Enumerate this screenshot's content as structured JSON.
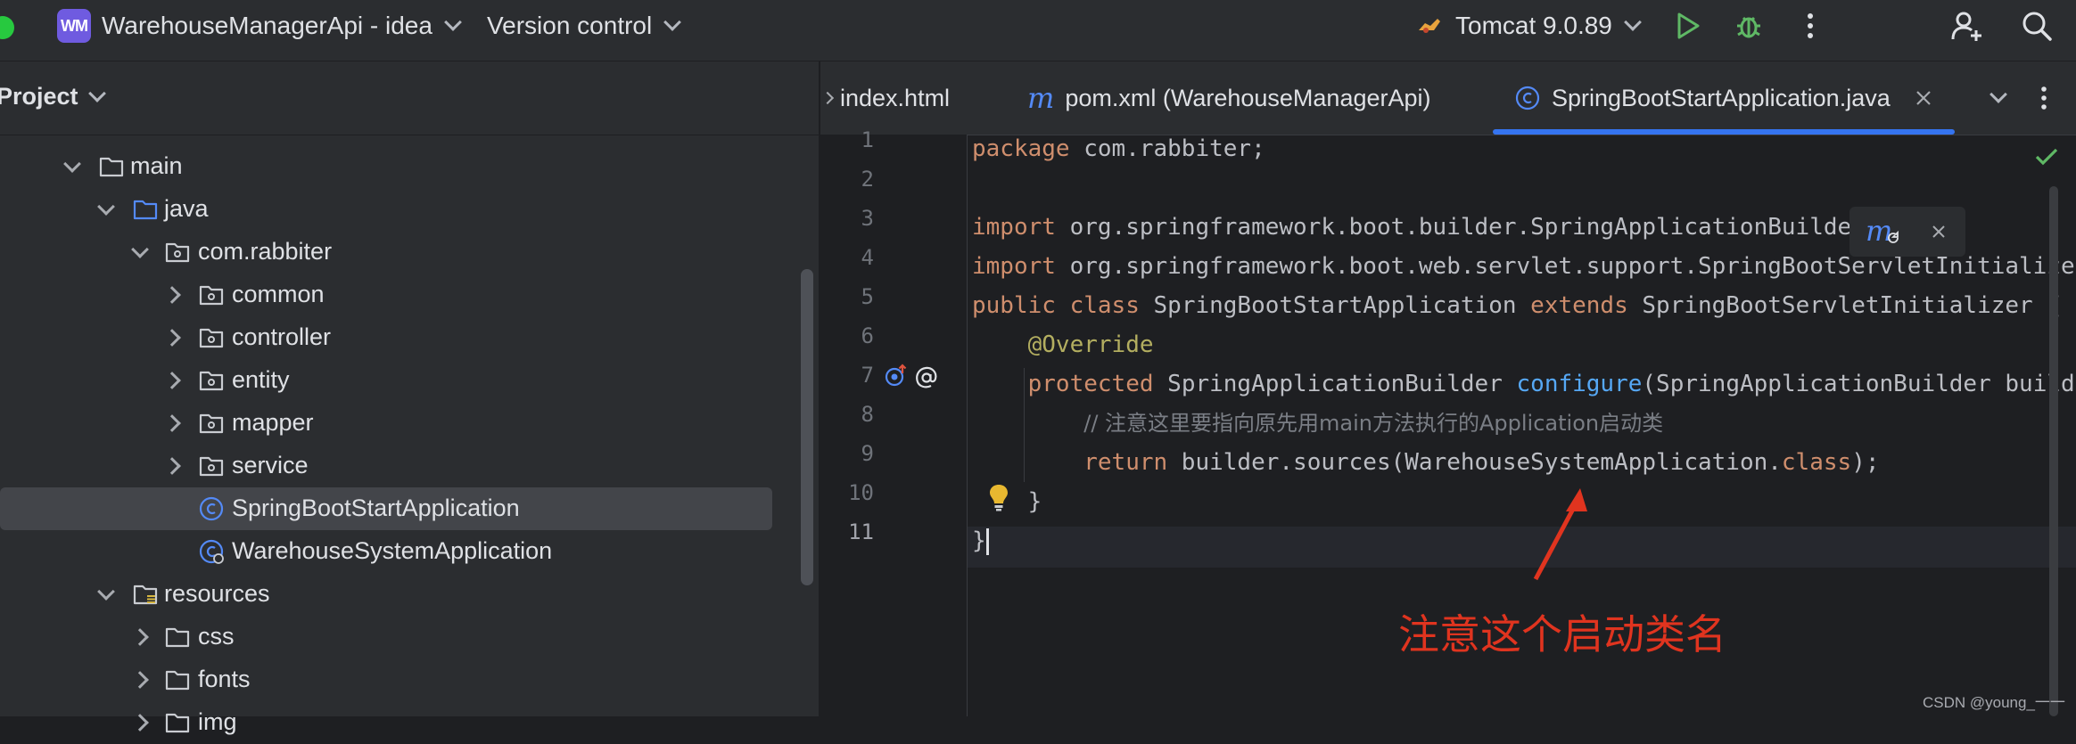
{
  "toolbar": {
    "project_badge": "WM",
    "project_name": "WarehouseManagerApi - idea",
    "version_control": "Version control",
    "run_config": "Tomcat 9.0.89"
  },
  "project_panel": {
    "title": "Project",
    "tree": [
      {
        "label": "main",
        "type": "folder",
        "expanded": true
      },
      {
        "label": "java",
        "type": "source-folder",
        "expanded": true
      },
      {
        "label": "com.rabbiter",
        "type": "package",
        "expanded": true
      },
      {
        "label": "common",
        "type": "package",
        "expanded": false
      },
      {
        "label": "controller",
        "type": "package",
        "expanded": false
      },
      {
        "label": "entity",
        "type": "package",
        "expanded": false
      },
      {
        "label": "mapper",
        "type": "package",
        "expanded": false
      },
      {
        "label": "service",
        "type": "package",
        "expanded": false
      },
      {
        "label": "SpringBootStartApplication",
        "type": "class",
        "selected": true
      },
      {
        "label": "WarehouseSystemApplication",
        "type": "boot-class"
      },
      {
        "label": "resources",
        "type": "resources-folder",
        "expanded": true
      },
      {
        "label": "css",
        "type": "folder",
        "expanded": false
      },
      {
        "label": "fonts",
        "type": "folder",
        "expanded": false
      },
      {
        "label": "img",
        "type": "folder",
        "expanded": false
      }
    ]
  },
  "editor": {
    "tabs": [
      {
        "label": "index.html",
        "active": false
      },
      {
        "label": "pom.xml (WarehouseManagerApi)",
        "icon": "m",
        "active": false
      },
      {
        "label": "SpringBootStartApplication.java",
        "active": true
      }
    ],
    "line_numbers": [
      "1",
      "2",
      "3",
      "4",
      "5",
      "6",
      "7",
      "8",
      "9",
      "10",
      "11"
    ],
    "code": {
      "l1": {
        "kw": "package",
        "rest": " com.rabbiter;"
      },
      "l3": {
        "kw": "import",
        "rest": " org.springframework.boot.builder.SpringApplicationBuilder;"
      },
      "l4": {
        "kw": "import",
        "rest": " org.springframework.boot.web.servlet.support.SpringBootServletInitializer;"
      },
      "l5": {
        "kw1": "public",
        "kw2": "class",
        "name": " SpringBootStartApplication ",
        "kw3": "extends",
        "rest": " SpringBootServletInitializer {"
      },
      "l6": {
        "ann": "@Override"
      },
      "l7": {
        "kw": "protected",
        "type": " SpringApplicationBuilder ",
        "fn": "configure",
        "rest": "(SpringApplicationBuilder builder) {"
      },
      "l8": {
        "comment": "// 注意这里要指向原先用main方法执行的Application启动类"
      },
      "l9": {
        "kw": "return",
        "rest1": " builder.sources(WarehouseSystemApplication.",
        "kw2": "class",
        "rest2": ");"
      },
      "l10": {
        "brace": "}"
      },
      "l11": {
        "brace": "}"
      }
    }
  },
  "annotation": {
    "text": "注意这个启动类名",
    "color": "#e0341f"
  },
  "watermark": "CSDN @young_一一"
}
